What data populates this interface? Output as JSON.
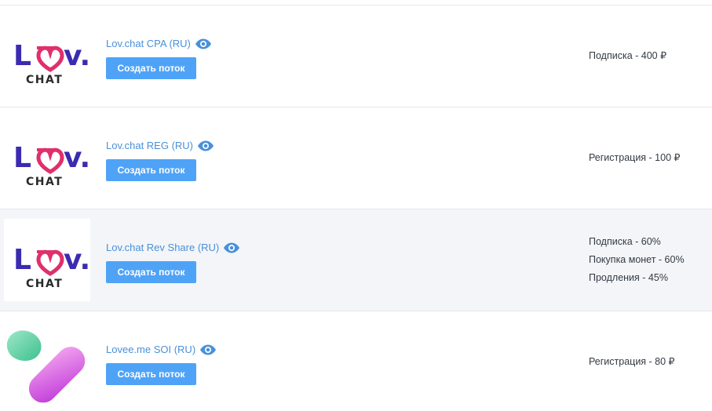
{
  "offers": [
    {
      "logo": "lov-chat-logo",
      "logo_text_top": "Lov.",
      "logo_text_bottom": "CHAT",
      "title": "Lov.chat CPA (RU)",
      "button_label": "Создать поток",
      "payouts": [
        "Подписка - 400 ₽"
      ]
    },
    {
      "logo": "lov-chat-logo",
      "logo_text_top": "Lov.",
      "logo_text_bottom": "CHAT",
      "title": "Lov.chat REG (RU)",
      "button_label": "Создать поток",
      "payouts": [
        "Регистрация - 100 ₽"
      ]
    },
    {
      "logo": "lov-chat-logo",
      "logo_text_top": "Lov.",
      "logo_text_bottom": "CHAT",
      "title": "Lov.chat Rev Share (RU)",
      "button_label": "Создать поток",
      "payouts": [
        "Подписка - 60%",
        "Покупка монет - 60%",
        "Продления - 45%"
      ]
    },
    {
      "logo": "lovee-me-logo",
      "title": "Lovee.me SOI (RU)",
      "button_label": "Создать поток",
      "payouts": [
        "Регистрация - 80 ₽"
      ]
    }
  ],
  "colors": {
    "link": "#4a90d9",
    "button": "#4fa3f7",
    "logo_purple": "#3b2bb0",
    "logo_pink": "#e0306b"
  }
}
